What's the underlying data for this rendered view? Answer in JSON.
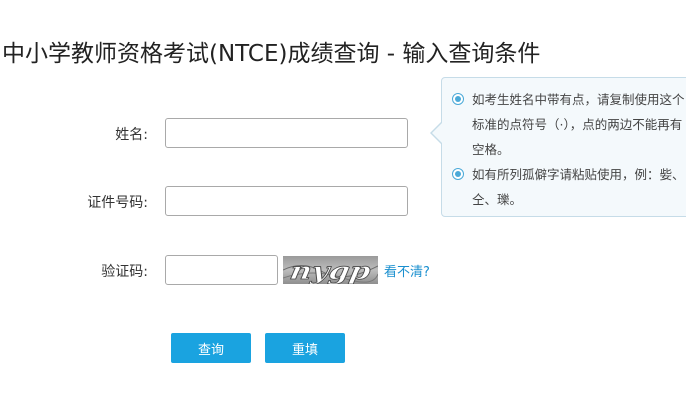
{
  "header": {
    "title": "中小学教师资格考试(NTCE)成绩查询 - 输入查询条件"
  },
  "form": {
    "name_label": "姓名:",
    "name_value": "",
    "id_label": "证件号码:",
    "id_value": "",
    "code_label": "验证码:",
    "code_value": "",
    "captcha_text": "nygp",
    "refresh_label": "看不清?",
    "query_button": "查询",
    "reset_button": "重填"
  },
  "tips": {
    "items": [
      "如考生姓名中带有点，请复制使用这个标准的点符号（·），点的两边不能再有空格。",
      "如有所列孤僻字请粘贴使用，例：姕、仝、瓅。"
    ]
  },
  "colors": {
    "accent": "#1aa3e0",
    "link": "#1a8fcf",
    "tip_background": "#f4f9fc",
    "tip_border": "#c6dce8"
  },
  "icons": {
    "tip_bullet": "radio-dot-icon"
  }
}
